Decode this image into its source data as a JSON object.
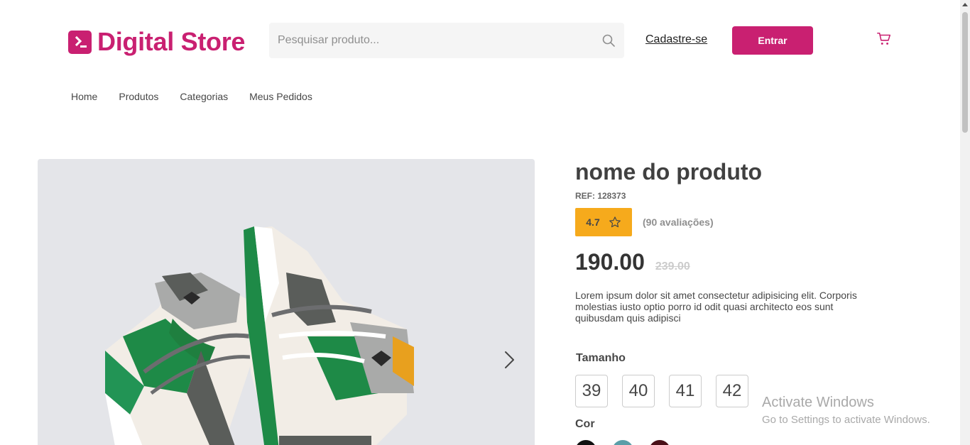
{
  "header": {
    "logo_text": "Digital Store",
    "search_placeholder": "Pesquisar produto...",
    "signup_label": "Cadastre-se",
    "login_label": "Entrar"
  },
  "nav": [
    "Home",
    "Produtos",
    "Categorias",
    "Meus Pedidos"
  ],
  "product": {
    "name": "nome do produto",
    "ref": "REF: 128373",
    "rating": "4.7",
    "reviews": "(90 avaliações)",
    "price": "190.00",
    "old_price": "239.00",
    "description": "Lorem ipsum dolor sit amet consectetur adipisicing elit. Corporis molestias iusto optio porro id odit quasi architecto eos sunt quibusdam quis adipisci",
    "size_label": "Tamanho",
    "sizes": [
      "39",
      "40",
      "41",
      "42"
    ],
    "color_label": "Cor",
    "colors": [
      "#111111",
      "#5a9ea8",
      "#4a1018"
    ]
  },
  "icons": {
    "search": "search-icon",
    "cart": "cart-icon",
    "star": "star-icon",
    "next": "chevron-right-icon"
  },
  "watermark": {
    "title": "Activate Windows",
    "subtitle": "Go to Settings to activate Windows."
  }
}
